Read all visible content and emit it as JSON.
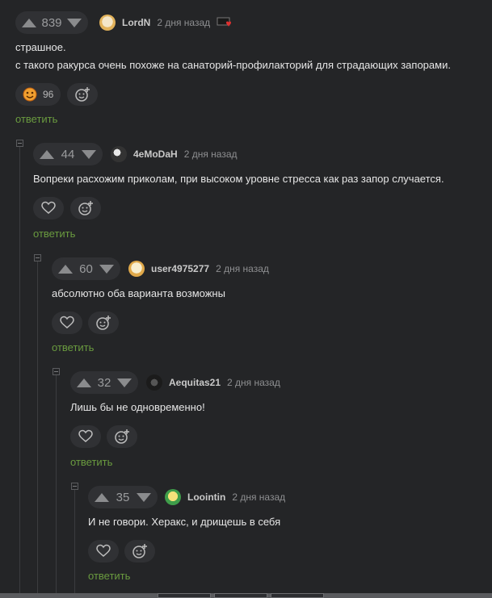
{
  "comments": [
    {
      "score": "839",
      "author": "LordN",
      "time": "2 дня назад",
      "text_lines": [
        "страшное.",
        "с такого ракурса очень похоже на санаторий-профилакторий для страдающих запорами."
      ],
      "reaction_count": "96",
      "reply_label": "ответить"
    },
    {
      "score": "44",
      "author": "4eMoDaH",
      "time": "2 дня назад",
      "text_lines": [
        "Вопреки расхожим приколам, при высоком уровне стресса как раз запор случается."
      ],
      "reply_label": "ответить"
    },
    {
      "score": "60",
      "author": "user4975277",
      "time": "2 дня назад",
      "text_lines": [
        "абсолютно оба варианта возможны"
      ],
      "reply_label": "ответить"
    },
    {
      "score": "32",
      "author": "Aequitas21",
      "time": "2 дня назад",
      "text_lines": [
        "Лишь бы не одновременно!"
      ],
      "reply_label": "ответить"
    },
    {
      "score": "35",
      "author": "Loointin",
      "time": "2 дня назад",
      "text_lines": [
        "И не говори. Херакс, и дрищешь в себя"
      ],
      "reply_label": "ответить"
    }
  ],
  "colors": {
    "background": "#242527",
    "reply_link": "#6a9b3f",
    "pill": "#303134"
  },
  "icons": [
    "arrow-up-icon",
    "arrow-down-icon",
    "heart-icon",
    "add-reaction-icon",
    "collapse-icon",
    "badge-icon",
    "smiling-face-icon"
  ]
}
